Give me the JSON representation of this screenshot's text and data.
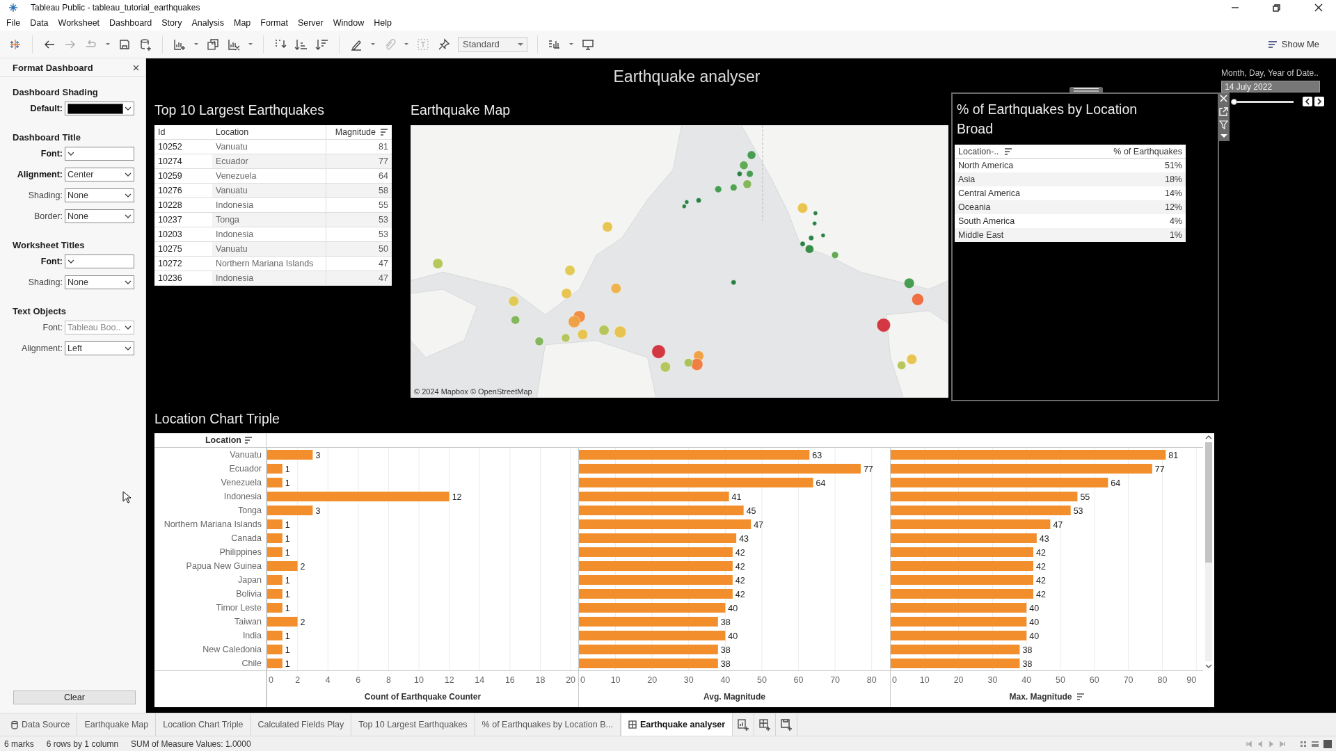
{
  "window": {
    "title": "Tableau Public - tableau_tutorial_earthquakes"
  },
  "menu": [
    "File",
    "Data",
    "Worksheet",
    "Dashboard",
    "Story",
    "Analysis",
    "Map",
    "Format",
    "Server",
    "Window",
    "Help"
  ],
  "toolbar": {
    "fit_dropdown": "Standard",
    "show_me": "Show Me"
  },
  "format_panel": {
    "title": "Format Dashboard",
    "sections": [
      {
        "heading": "Dashboard Shading",
        "fields": [
          {
            "label": "Default:",
            "kind": "color",
            "color": "#000000",
            "emphasized": true,
            "dimmed": false
          }
        ]
      },
      {
        "heading": "Dashboard Title",
        "fields": [
          {
            "label": "Font:",
            "kind": "select",
            "emphasized": true,
            "dimmed": false
          },
          {
            "label": "Alignment:",
            "kind": "select",
            "value": "Center",
            "emphasized": true,
            "dimmed": false
          },
          {
            "label": "Shading:",
            "kind": "select",
            "value": "None",
            "emphasized": false,
            "dimmed": false
          },
          {
            "label": "Border:",
            "kind": "select",
            "value": "None",
            "emphasized": false,
            "dimmed": false
          }
        ]
      },
      {
        "heading": "Worksheet Titles",
        "fields": [
          {
            "label": "Font:",
            "kind": "select",
            "emphasized": true,
            "dimmed": false
          },
          {
            "label": "Shading:",
            "kind": "select",
            "value": "None",
            "emphasized": false,
            "dimmed": false
          }
        ]
      },
      {
        "heading": "Text Objects",
        "fields": [
          {
            "label": "Font:",
            "kind": "select",
            "value": "Tableau Boo..",
            "emphasized": false,
            "dimmed": true
          },
          {
            "label": "Alignment:",
            "kind": "select",
            "value": "Left",
            "emphasized": false,
            "dimmed": false
          }
        ]
      }
    ],
    "clear_button": "Clear"
  },
  "dashboard": {
    "title": "Earthquake analyser",
    "top10": {
      "title": "Top 10 Largest Earthquakes",
      "columns": [
        "Id",
        "Location",
        "Magnitude"
      ],
      "rows": [
        {
          "id": "10252",
          "location": "Vanuatu",
          "magnitude": "81"
        },
        {
          "id": "10274",
          "location": "Ecuador",
          "magnitude": "77"
        },
        {
          "id": "10259",
          "location": "Venezuela",
          "magnitude": "64"
        },
        {
          "id": "10276",
          "location": "Vanuatu",
          "magnitude": "58"
        },
        {
          "id": "10228",
          "location": "Indonesia",
          "magnitude": "55"
        },
        {
          "id": "10237",
          "location": "Tonga",
          "magnitude": "53"
        },
        {
          "id": "10203",
          "location": "Indonesia",
          "magnitude": "53"
        },
        {
          "id": "10275",
          "location": "Vanuatu",
          "magnitude": "50"
        },
        {
          "id": "10272",
          "location": "Northern Mariana Islands",
          "magnitude": "47"
        },
        {
          "id": "10236",
          "location": "Indonesia",
          "magnitude": "47"
        }
      ]
    },
    "map": {
      "title": "Earthquake Map",
      "attribution": "© 2024 Mapbox © OpenStreetMap"
    },
    "location_panel": {
      "title": "% of Earthquakes by Location Broad",
      "columns": [
        "Location-..",
        "% of Earthquakes"
      ],
      "rows": [
        {
          "location": "North America",
          "percent": "51%"
        },
        {
          "location": "Asia",
          "percent": "18%"
        },
        {
          "location": "Central America",
          "percent": "14%"
        },
        {
          "location": "Oceania",
          "percent": "12%"
        },
        {
          "location": "South America",
          "percent": "4%"
        },
        {
          "location": "Middle East",
          "percent": "1%"
        }
      ]
    },
    "date_filter": {
      "label": "Month, Day, Year of Date..",
      "value": "14 July 2022",
      "level": 0
    },
    "location_chart": {
      "title": "Location Chart Triple",
      "row_header": "Location",
      "panes": [
        {
          "sorted": false,
          "chart_data": {
            "type": "bar",
            "orientation": "horizontal",
            "grid": true,
            "xlabel": "Count of Earthquake Counter",
            "categories": [
              "Vanuatu",
              "Ecuador",
              "Venezuela",
              "Indonesia",
              "Tonga",
              "Northern Mariana Islands",
              "Canada",
              "Philippines",
              "Papua New Guinea",
              "Japan",
              "Bolivia",
              "Timor Leste",
              "Taiwan",
              "India",
              "New Caledonia",
              "Chile"
            ],
            "values": [
              3,
              1,
              1,
              12,
              3,
              1,
              1,
              1,
              2,
              1,
              1,
              1,
              2,
              1,
              1,
              1
            ],
            "xlim": [
              0,
              20.5
            ],
            "xticks": [
              0,
              2,
              4,
              6,
              8,
              10,
              12,
              14,
              16,
              18,
              20
            ],
            "data_labels": true
          }
        },
        {
          "sorted": false,
          "chart_data": {
            "type": "bar",
            "orientation": "horizontal",
            "grid": true,
            "xlabel": "Avg. Magnitude",
            "values": [
              63,
              77,
              64,
              41,
              45,
              47,
              43,
              42,
              42,
              42,
              42,
              40,
              38,
              40,
              38,
              38
            ],
            "xlim": [
              0,
              85
            ],
            "xticks": [
              0,
              10,
              20,
              30,
              40,
              50,
              60,
              70,
              80
            ],
            "data_labels": true
          }
        },
        {
          "sorted": true,
          "chart_data": {
            "type": "bar",
            "orientation": "horizontal",
            "grid": true,
            "xlabel": "Max. Magnitude",
            "values": [
              81,
              77,
              64,
              55,
              53,
              47,
              43,
              42,
              42,
              42,
              42,
              40,
              40,
              40,
              38,
              38
            ],
            "xlim": [
              0,
              92
            ],
            "xticks": [
              0,
              10,
              20,
              30,
              40,
              50,
              60,
              70,
              80,
              90
            ],
            "data_labels": true
          }
        }
      ]
    }
  },
  "tabs": [
    {
      "label": "Data Source",
      "kind": "datasource",
      "selected": false
    },
    {
      "label": "Earthquake Map",
      "kind": "sheet",
      "selected": false
    },
    {
      "label": "Location Chart Triple",
      "kind": "sheet",
      "selected": false
    },
    {
      "label": "Calculated Fields Play",
      "kind": "sheet",
      "selected": false
    },
    {
      "label": "Top 10 Largest Earthquakes",
      "kind": "sheet",
      "selected": false
    },
    {
      "label": "% of Earthquakes by Location B...",
      "kind": "sheet",
      "selected": false
    },
    {
      "label": "Earthquake analyser",
      "kind": "dashboard",
      "selected": true
    }
  ],
  "status_bar": [
    "6 marks",
    "6 rows by 1 column",
    "SUM of Measure Values: 1.0000"
  ]
}
